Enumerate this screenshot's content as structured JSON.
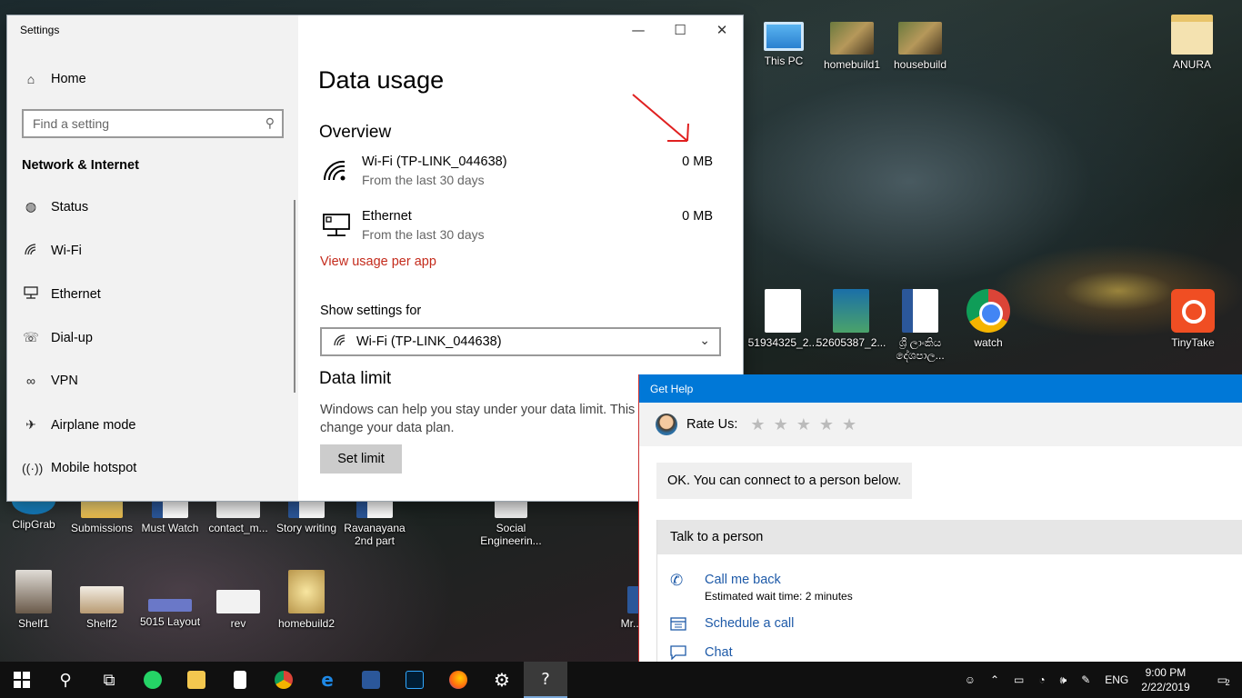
{
  "desktop": {
    "icons": [
      {
        "label": "This PC"
      },
      {
        "label": "homebuild1"
      },
      {
        "label": "housebuild"
      },
      {
        "label": "ANURA"
      },
      {
        "label": "51934325_2..."
      },
      {
        "label": "52605387_2..."
      },
      {
        "label": "ශ්‍රී ලාංකිය දේශපාල..."
      },
      {
        "label": "watch"
      },
      {
        "label": "TinyTake"
      },
      {
        "label": "ClipGrab"
      },
      {
        "label": "Submissions"
      },
      {
        "label": "Must Watch"
      },
      {
        "label": "contact_m..."
      },
      {
        "label": "Story writing"
      },
      {
        "label": "Ravanayana 2nd part"
      },
      {
        "label": "Social Engineerin..."
      },
      {
        "label": "Shelf1"
      },
      {
        "label": "Shelf2"
      },
      {
        "label": "5015 Layout"
      },
      {
        "label": "rev"
      },
      {
        "label": "homebuild2"
      },
      {
        "label": "Mr..."
      }
    ]
  },
  "settings": {
    "title": "Settings",
    "sidebar": {
      "home": "Home",
      "search_placeholder": "Find a setting",
      "heading": "Network & Internet",
      "items": [
        {
          "label": "Status"
        },
        {
          "label": "Wi-Fi"
        },
        {
          "label": "Ethernet"
        },
        {
          "label": "Dial-up"
        },
        {
          "label": "VPN"
        },
        {
          "label": "Airplane mode"
        },
        {
          "label": "Mobile hotspot"
        }
      ]
    },
    "main": {
      "title": "Data usage",
      "overview_title": "Overview",
      "rows": [
        {
          "name": "Wi-Fi (TP-LINK_044638)",
          "sub": "From the last 30 days",
          "value": "0 MB"
        },
        {
          "name": "Ethernet",
          "sub": "From the last 30 days",
          "value": "0 MB"
        }
      ],
      "view_usage_link": "View usage per app",
      "show_settings_label": "Show settings for",
      "dropdown_value": "Wi-Fi (TP-LINK_044638)",
      "data_limit_title": "Data limit",
      "data_limit_desc": "Windows can help you stay under your data limit. This will help you change your data plan.",
      "set_limit_button": "Set limit"
    }
  },
  "get_help": {
    "title": "Get Help",
    "rate_label": "Rate Us:",
    "stars": 5,
    "message": "OK. You can connect to a person below.",
    "talk_heading": "Talk to a person",
    "options": [
      {
        "title": "Call me back",
        "sub": "Estimated wait time: 2 minutes"
      },
      {
        "title": "Schedule a call",
        "sub": ""
      },
      {
        "title": "Chat",
        "sub": ""
      }
    ]
  },
  "taskbar": {
    "language": "ENG",
    "time": "9:00 PM",
    "date": "2/22/2019",
    "notifications": "2"
  },
  "colors": {
    "accent": "#0078d7",
    "link_red": "#c42b1c",
    "link_blue": "#1e5aa8"
  }
}
